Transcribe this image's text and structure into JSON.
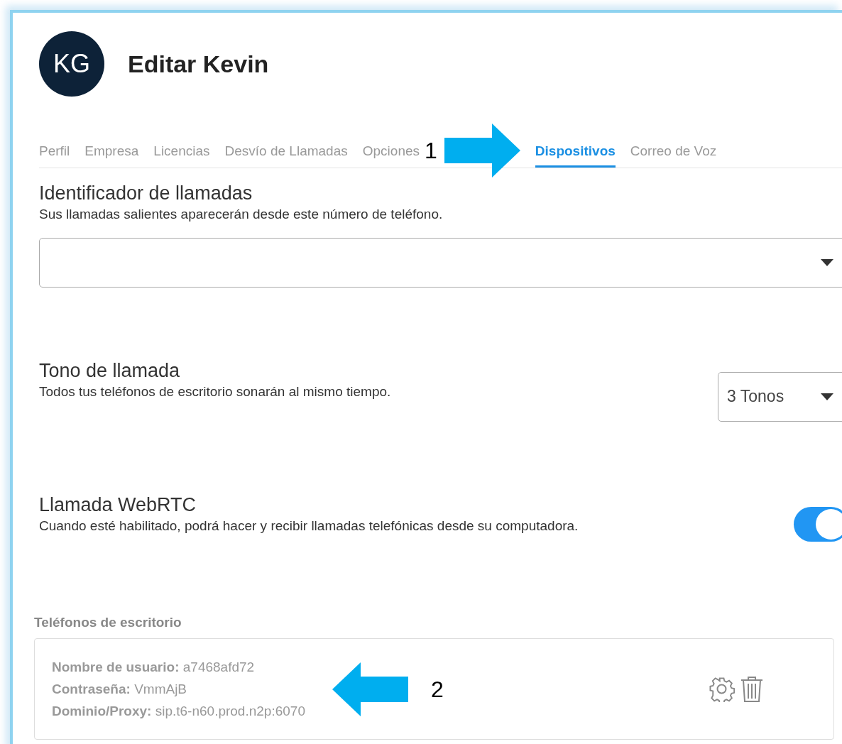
{
  "header": {
    "initials": "KG",
    "title": "Editar Kevin"
  },
  "tabs": [
    {
      "label": "Perfil",
      "selected": false
    },
    {
      "label": "Empresa",
      "selected": false
    },
    {
      "label": "Licencias",
      "selected": false
    },
    {
      "label": "Desvío de Llamadas",
      "selected": false
    },
    {
      "label": "Opciones",
      "selected": false
    },
    {
      "label": "Dispositivos",
      "selected": true
    },
    {
      "label": "Correo de Voz",
      "selected": false
    }
  ],
  "annotations": [
    {
      "number": "1",
      "points_left": false
    },
    {
      "number": "2",
      "points_left": true
    }
  ],
  "caller_id": {
    "title": "Identificador de llamadas",
    "description": "Sus llamadas salientes aparecerán desde este número de teléfono."
  },
  "ring_tone": {
    "title": "Tono de llamada",
    "description": "Todos tus teléfonos de escritorio sonarán al mismo tiempo.",
    "value": "3 Tonos"
  },
  "webrtc": {
    "title": "Llamada WebRTC",
    "description": "Cuando esté habilitado, podrá hacer y recibir llamadas telefónicas desde su computadora.",
    "on": true
  },
  "desk_phones": {
    "heading": "Teléfonos de escritorio",
    "entries": [
      {
        "lines": [
          "**Nombre de usuario:** a7468afd72",
          "**Contraseña:** VmmAjB",
          "**Dominio/Proxy:** sip.t6-n60.prod.n2p:6070"
        ]
      }
    ]
  }
}
